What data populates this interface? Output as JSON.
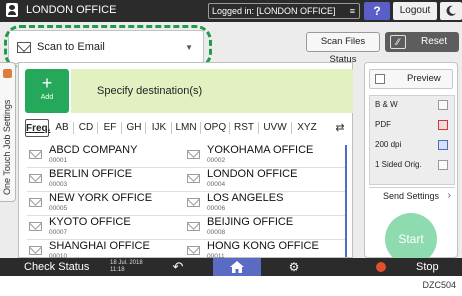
{
  "topbar": {
    "user_name": "LONDON OFFICE",
    "login_status": "Logged in: [LONDON OFFICE]",
    "help_label": "?",
    "logout_label": "Logout"
  },
  "app": {
    "title": "Scan to Email",
    "scan_files_status_label": "Scan Files Status",
    "reset_label": "Reset"
  },
  "side_tab": {
    "label": "One Touch Job Settings"
  },
  "destination": {
    "add_plus": "+",
    "add_label": "Add",
    "specify_label": "Specify destination(s)",
    "index_tabs": [
      "Freq.",
      "AB",
      "CD",
      "EF",
      "GH",
      "IJK",
      "LMN",
      "OPQ",
      "RST",
      "UVW",
      "XYZ"
    ],
    "active_index": "Freq.",
    "entries": [
      {
        "name": "ABCD COMPANY",
        "number": "00001"
      },
      {
        "name": "YOKOHAMA OFFICE",
        "number": "00002"
      },
      {
        "name": "BERLIN OFFICE",
        "number": "00003"
      },
      {
        "name": "LONDON OFFICE",
        "number": "00004"
      },
      {
        "name": "NEW YORK OFFICE",
        "number": "00005"
      },
      {
        "name": "LOS ANGELES",
        "number": "00006"
      },
      {
        "name": "KYOTO OFFICE",
        "number": "00007"
      },
      {
        "name": "BEIJING OFFICE",
        "number": "00008"
      },
      {
        "name": "SHANGHAI OFFICE",
        "number": "00010"
      },
      {
        "name": "HONG KONG OFFICE",
        "number": "00011"
      }
    ]
  },
  "right_panel": {
    "preview_label": "Preview",
    "preview_checked": false,
    "settings": {
      "color": "B & W",
      "file_type": "PDF",
      "resolution": "200 dpi",
      "original": "1 Sided Orig."
    },
    "send_settings_label": "Send Settings",
    "start_label": "Start"
  },
  "bottombar": {
    "check_status_label": "Check Status",
    "date": "18 Jul. 2018",
    "time": "11:18",
    "stop_label": "Stop"
  },
  "figure_code": "DZC504",
  "colors": {
    "highlight": "#1e9b4b",
    "add_button": "#25a85a",
    "specify_bg": "#e3f1c2",
    "start_button": "#8fdbb0",
    "home_button": "#5b6ac2",
    "help_button": "#5a5fc8",
    "stop_icon": "#e0502d"
  }
}
